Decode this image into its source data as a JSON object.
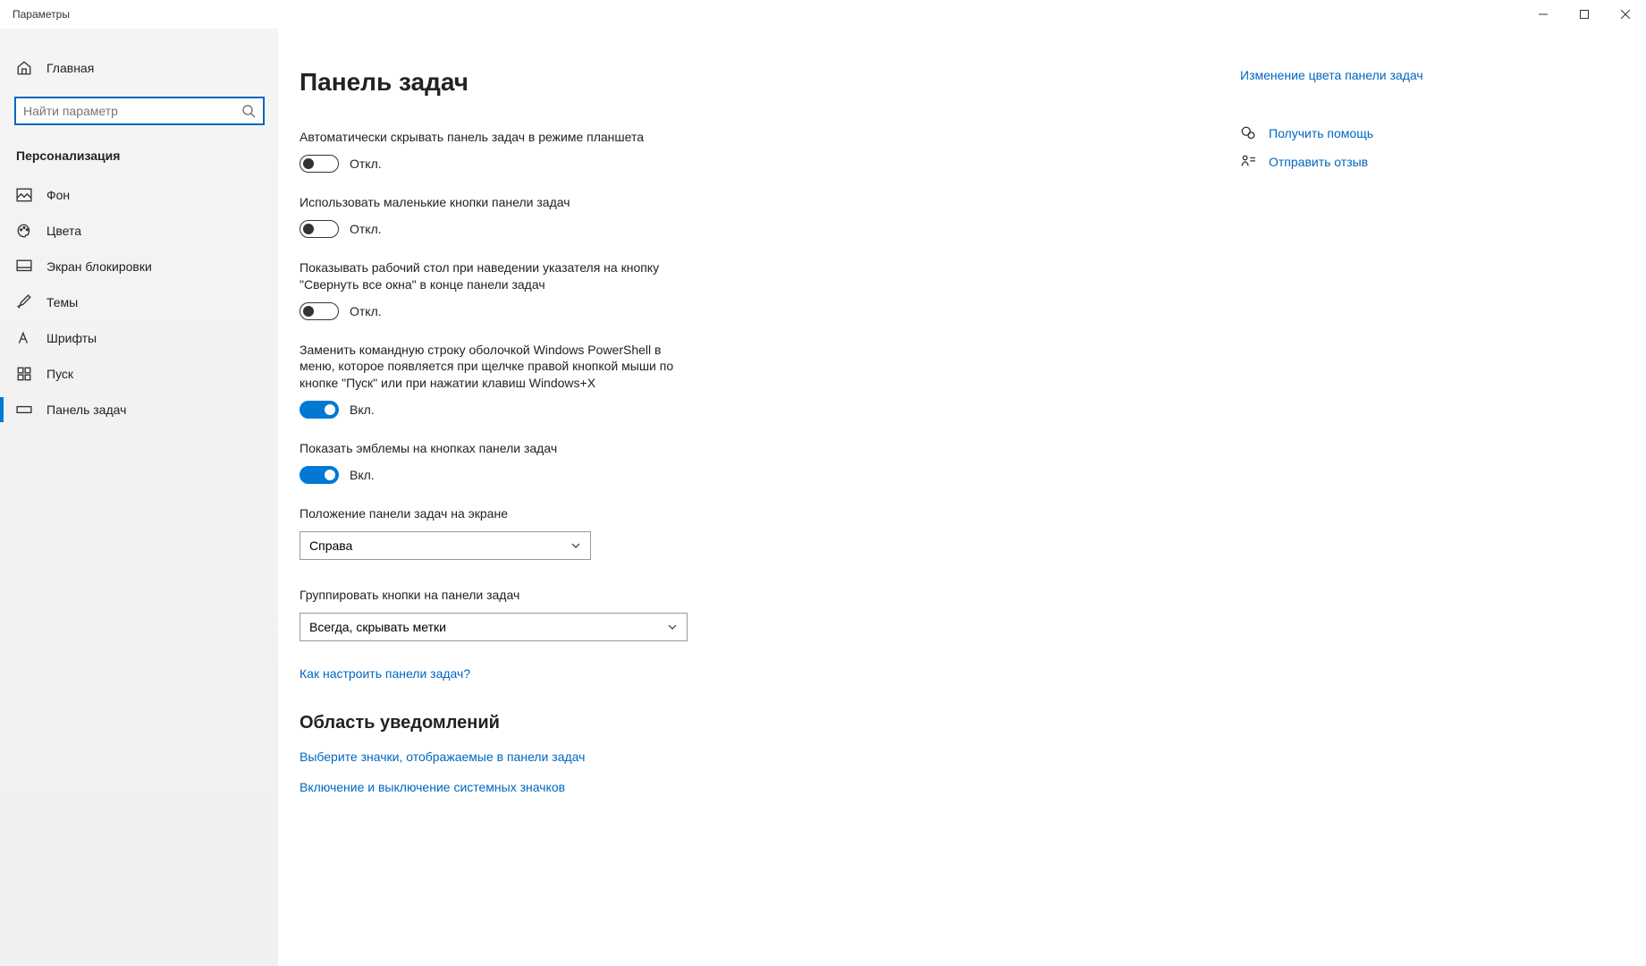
{
  "window": {
    "title": "Параметры"
  },
  "sidebar": {
    "home": "Главная",
    "search_placeholder": "Найти параметр",
    "category": "Персонализация",
    "items": [
      {
        "label": "Фон"
      },
      {
        "label": "Цвета"
      },
      {
        "label": "Экран блокировки"
      },
      {
        "label": "Темы"
      },
      {
        "label": "Шрифты"
      },
      {
        "label": "Пуск"
      },
      {
        "label": "Панель задач"
      }
    ]
  },
  "page": {
    "title": "Панель задач"
  },
  "settings": {
    "autohide_tablet": {
      "label": "Автоматически скрывать панель задач в режиме планшета",
      "state": "Откл."
    },
    "small_buttons": {
      "label": "Использовать маленькие кнопки панели задач",
      "state": "Откл."
    },
    "show_desktop_peek": {
      "label": "Показывать рабочий стол при наведении указателя на кнопку \"Свернуть все окна\" в конце панели задач",
      "state": "Откл."
    },
    "powershell": {
      "label": "Заменить командную строку оболочкой Windows PowerShell в меню, которое появляется при щелчке правой кнопкой мыши по кнопке \"Пуск\" или при нажатии клавиш Windows+X",
      "state": "Вкл."
    },
    "badges": {
      "label": "Показать эмблемы на кнопках панели задач",
      "state": "Вкл."
    },
    "position": {
      "label": "Положение панели задач на экране",
      "value": "Справа"
    },
    "combine": {
      "label": "Группировать кнопки на панели задач",
      "value": "Всегда, скрывать метки"
    },
    "howto_link": "Как настроить панели задач?"
  },
  "notification_area": {
    "heading": "Область уведомлений",
    "select_icons": "Выберите значки, отображаемые в панели задач",
    "system_icons": "Включение и выключение системных значков"
  },
  "aside": {
    "color_link": "Изменение цвета панели задач",
    "help": "Получить помощь",
    "feedback": "Отправить отзыв"
  }
}
